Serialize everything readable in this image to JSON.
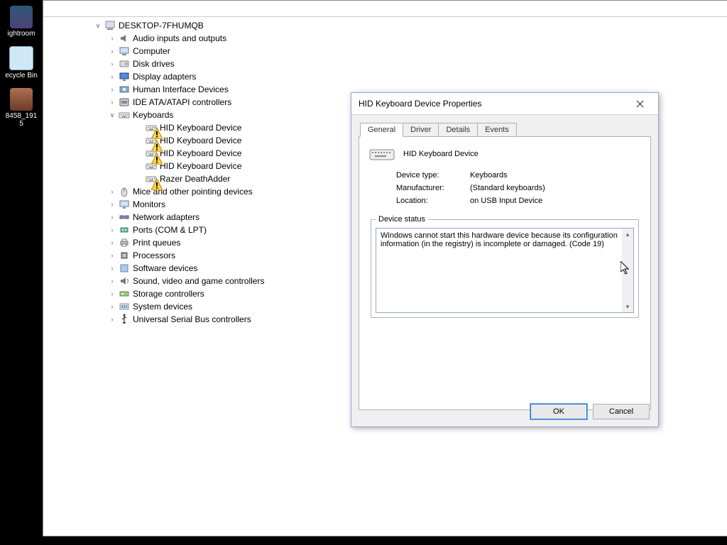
{
  "desktop": {
    "icons": [
      {
        "name": "ightroom",
        "iconClass": "ico-lightroom"
      },
      {
        "name": "ecycle Bin",
        "iconClass": "ico-bin"
      },
      {
        "name": "8458_1915",
        "iconClass": "ico-photo"
      }
    ]
  },
  "devmgr": {
    "root": "DESKTOP-7FHUMQB",
    "categories": [
      {
        "label": "Audio inputs and outputs",
        "icon": "audio",
        "expanded": false
      },
      {
        "label": "Computer",
        "icon": "computer",
        "expanded": false
      },
      {
        "label": "Disk drives",
        "icon": "disk",
        "expanded": false
      },
      {
        "label": "Display adapters",
        "icon": "display",
        "expanded": false
      },
      {
        "label": "Human Interface Devices",
        "icon": "hid",
        "expanded": false
      },
      {
        "label": "IDE ATA/ATAPI controllers",
        "icon": "ide",
        "expanded": false
      },
      {
        "label": "Keyboards",
        "icon": "keyboard",
        "expanded": true,
        "children": [
          {
            "label": "HID Keyboard Device",
            "icon": "keyboard",
            "warn": true
          },
          {
            "label": "HID Keyboard Device",
            "icon": "keyboard",
            "warn": true
          },
          {
            "label": "HID Keyboard Device",
            "icon": "keyboard",
            "warn": true
          },
          {
            "label": "HID Keyboard Device",
            "icon": "keyboard",
            "warn": false
          },
          {
            "label": "Razer DeathAdder",
            "icon": "keyboard",
            "warn": true
          }
        ]
      },
      {
        "label": "Mice and other pointing devices",
        "icon": "mouse",
        "expanded": false
      },
      {
        "label": "Monitors",
        "icon": "monitor",
        "expanded": false
      },
      {
        "label": "Network adapters",
        "icon": "network",
        "expanded": false
      },
      {
        "label": "Ports (COM & LPT)",
        "icon": "ports",
        "expanded": false
      },
      {
        "label": "Print queues",
        "icon": "printer",
        "expanded": false
      },
      {
        "label": "Processors",
        "icon": "cpu",
        "expanded": false
      },
      {
        "label": "Software devices",
        "icon": "software",
        "expanded": false
      },
      {
        "label": "Sound, video and game controllers",
        "icon": "sound",
        "expanded": false
      },
      {
        "label": "Storage controllers",
        "icon": "storage",
        "expanded": false
      },
      {
        "label": "System devices",
        "icon": "system",
        "expanded": false
      },
      {
        "label": "Universal Serial Bus controllers",
        "icon": "usb",
        "expanded": false
      }
    ]
  },
  "propdlg": {
    "title": "HID Keyboard Device Properties",
    "tabs": [
      "General",
      "Driver",
      "Details",
      "Events"
    ],
    "active_tab": "General",
    "device_name": "HID Keyboard Device",
    "props": {
      "type_label": "Device type:",
      "type_value": "Keyboards",
      "mfr_label": "Manufacturer:",
      "mfr_value": "(Standard keyboards)",
      "loc_label": "Location:",
      "loc_value": "on USB Input Device"
    },
    "status_label": "Device status",
    "status_text": "Windows cannot start this hardware device because its configuration information (in the registry) is incomplete or damaged. (Code 19)",
    "ok_label": "OK",
    "cancel_label": "Cancel"
  }
}
